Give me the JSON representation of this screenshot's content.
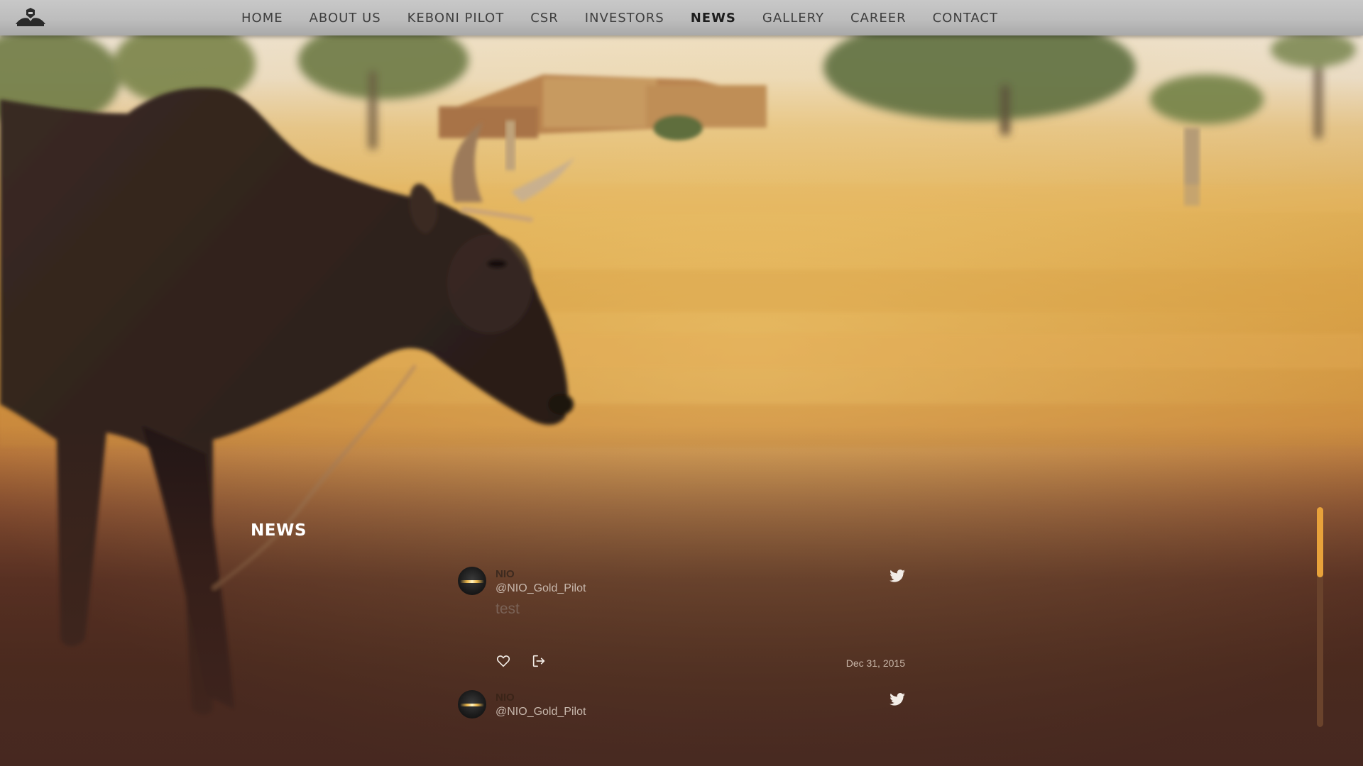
{
  "nav": {
    "items": [
      "HOME",
      "ABOUT US",
      "KEBONI PILOT",
      "CSR",
      "INVESTORS",
      "NEWS",
      "GALLERY",
      "CAREER",
      "CONTACT"
    ],
    "active": "NEWS"
  },
  "icons": {
    "logo": "company-emblem-icon",
    "twitter": "twitter-bird-icon",
    "like": "heart-icon",
    "share": "share-arrow-icon"
  },
  "colors": {
    "header": "#bdbdbd",
    "scroll_thumb": "#e8a23a",
    "heading": "#ffffff"
  },
  "news": {
    "heading": "NEWS",
    "tweets": [
      {
        "name": "NIO",
        "handle": "@NIO_Gold_Pilot",
        "text": "test",
        "date": "Dec 31, 2015"
      },
      {
        "name": "NIO",
        "handle": "@NIO_Gold_Pilot"
      }
    ]
  },
  "scroll": {
    "position_fraction": 0.0,
    "visible_fraction": 0.32
  }
}
